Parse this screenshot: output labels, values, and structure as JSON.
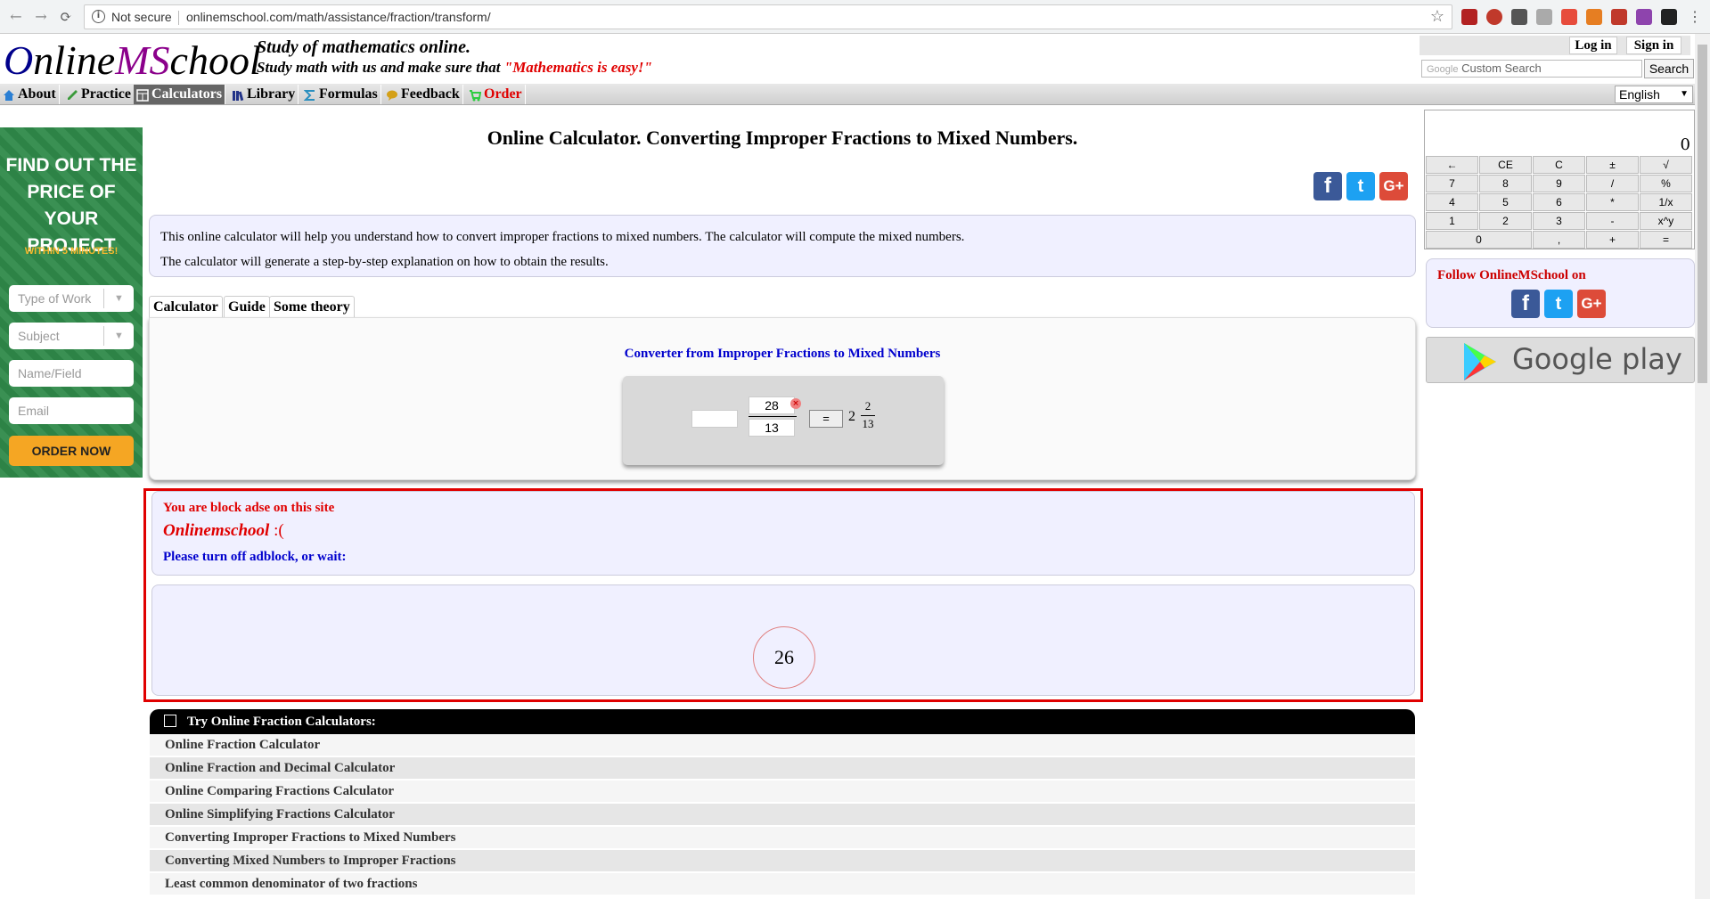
{
  "browser": {
    "security": "Not secure",
    "url": "onlinemschool.com/math/assistance/fraction/transform/"
  },
  "header": {
    "logo": {
      "o": "O",
      "nline": "nline",
      "ms": "MS",
      "chool": "chool"
    },
    "tagline1": "Study of mathematics online.",
    "tagline2_prefix": "Study math with us and make sure that ",
    "tagline2_emph": "\"Mathematics is easy!\"",
    "login": "Log in",
    "signin": "Sign in",
    "search_prefix": "Google",
    "search_placeholder": "Custom Search",
    "search_button": "Search",
    "language": "English"
  },
  "nav": {
    "items": [
      {
        "label": "About",
        "color": "#2a7fd4"
      },
      {
        "label": "Practice",
        "color": "#3a9a3a"
      },
      {
        "label": "Calculators",
        "color": "#ffffff"
      },
      {
        "label": "Library",
        "color": "#223388"
      },
      {
        "label": "Formulas",
        "color": "#2a8fbf"
      },
      {
        "label": "Feedback",
        "color": "#d4a017"
      },
      {
        "label": "Order",
        "color": "#2ecc40"
      }
    ]
  },
  "left_ad": {
    "headline": [
      "FIND OUT THE",
      "PRICE OF YOUR",
      "PROJECT"
    ],
    "subline": "WITHIN 5 MINUTES!",
    "type_of_work": "Type of Work",
    "subject": "Subject",
    "name_field": "Name/Field",
    "email": "Email",
    "button": "ORDER NOW"
  },
  "main": {
    "title": "Online Calculator. Converting Improper Fractions to Mixed Numbers.",
    "intro1": "This online calculator will help you understand how to convert improper fractions to mixed numbers. The calculator will compute the mixed numbers.",
    "intro2": "The calculator will generate a step-by-step explanation on how to obtain the results.",
    "tabs": [
      "Calculator",
      "Guide",
      "Some theory"
    ],
    "converter_title": "Converter from Improper Fractions to Mixed Numbers",
    "input": {
      "whole": "",
      "numerator": "28",
      "denominator": "13"
    },
    "equals": "=",
    "result": {
      "whole": "2",
      "numerator": "2",
      "denominator": "13"
    }
  },
  "adblock": {
    "line1": "You are block adse on this site",
    "line2": "Onlinemschool",
    "line2_suffix": " :(",
    "line3": "Please turn off adblock, or wait:",
    "countdown": "26"
  },
  "fraction_calcs": {
    "header": "Try Online Fraction Calculators:",
    "items": [
      "Online Fraction Calculator",
      "Online Fraction and Decimal Calculator",
      "Online Comparing Fractions Calculator",
      "Online Simplifying Fractions Calculator",
      "Converting Improper Fractions to Mixed Numbers",
      "Converting Mixed Numbers to Improper Fractions",
      "Least common denominator of two fractions"
    ]
  },
  "right_calc": {
    "display": "0",
    "keys": [
      [
        "←",
        "CE",
        "C",
        "±",
        "√"
      ],
      [
        "7",
        "8",
        "9",
        "/",
        "%"
      ],
      [
        "4",
        "5",
        "6",
        "*",
        "1/x"
      ],
      [
        "1",
        "2",
        "3",
        "-",
        "x^y"
      ],
      [
        "0",
        ",",
        "+",
        "="
      ]
    ]
  },
  "follow": {
    "title": "Follow OnlineMSchool on"
  },
  "google_play": "Google play",
  "social_glyphs": {
    "fb": "f",
    "tw": "t",
    "gp": "G+"
  }
}
